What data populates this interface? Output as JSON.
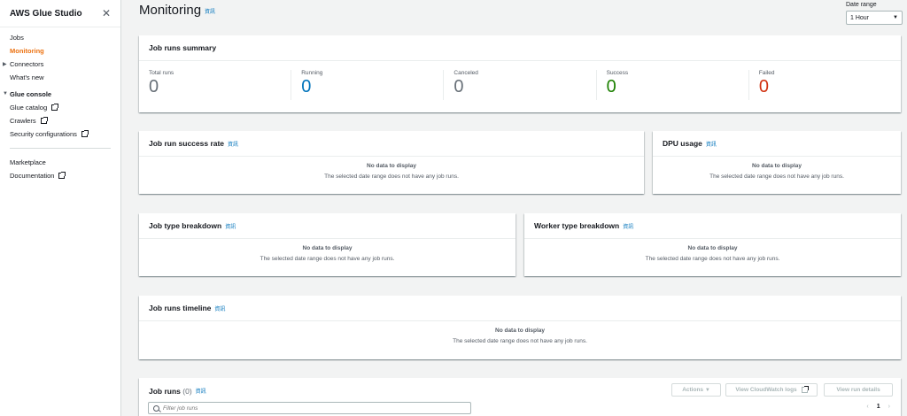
{
  "sidebar": {
    "title": "AWS Glue Studio",
    "items_top": [
      {
        "label": "Jobs"
      },
      {
        "label": "Monitoring"
      },
      {
        "label": "Connectors"
      },
      {
        "label": "What's new"
      }
    ],
    "glue_section": "Glue console",
    "glue_items": [
      {
        "label": "Glue catalog"
      },
      {
        "label": "Crawlers"
      },
      {
        "label": "Security configurations"
      }
    ],
    "bottom_items": [
      {
        "label": "Marketplace"
      },
      {
        "label": "Documentation"
      }
    ]
  },
  "header": {
    "title": "Monitoring",
    "info": "資訊",
    "date_range_label": "Date range",
    "date_range_value": "1 Hour"
  },
  "summary": {
    "title": "Job runs summary",
    "metrics": [
      {
        "label": "Total runs",
        "value": "0",
        "color": "#687078"
      },
      {
        "label": "Running",
        "value": "0",
        "color": "#0073bb"
      },
      {
        "label": "Canceled",
        "value": "0",
        "color": "#687078"
      },
      {
        "label": "Success",
        "value": "0",
        "color": "#1d8102"
      },
      {
        "label": "Failed",
        "value": "0",
        "color": "#d13212"
      }
    ]
  },
  "nodata": {
    "title": "No data to display",
    "message": "The selected date range does not have any job runs."
  },
  "panels": {
    "success_rate": "Job run success rate",
    "dpu_usage": "DPU usage",
    "job_type": "Job type breakdown",
    "worker_type": "Worker type breakdown",
    "timeline": "Job runs timeline"
  },
  "job_runs": {
    "title": "Job runs",
    "count": "(0)",
    "actions": "Actions",
    "cloudwatch": "View CloudWatch logs",
    "view_details": "View run details",
    "filter_placeholder": "Filter job runs",
    "page": "1"
  }
}
